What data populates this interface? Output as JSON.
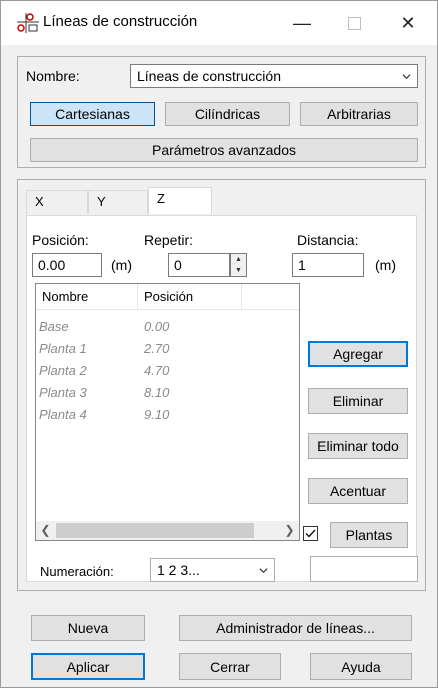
{
  "window": {
    "title": "Líneas de construcción",
    "controls": {
      "minimize": "—",
      "close": "✕"
    }
  },
  "name_section": {
    "label": "Nombre:",
    "value": "Líneas de construcción"
  },
  "coord_buttons": {
    "cartesian": "Cartesianas",
    "cylindrical": "Cilíndricas",
    "arbitrary": "Arbitrarias"
  },
  "advanced_button": "Parámetros avanzados",
  "tabs": [
    "X",
    "Y",
    "Z"
  ],
  "active_tab": "Z",
  "position": {
    "label": "Posición:",
    "value": "0.00",
    "unit": "(m)"
  },
  "repeat": {
    "label": "Repetir:",
    "value": "0"
  },
  "distance": {
    "label": "Distancia:",
    "value": "1",
    "unit": "(m)"
  },
  "list": {
    "columns": [
      "Nombre",
      "Posición"
    ],
    "rows": [
      {
        "name": "Base",
        "position": "0.00"
      },
      {
        "name": "Planta 1",
        "position": "2.70"
      },
      {
        "name": "Planta 2",
        "position": "4.70"
      },
      {
        "name": "Planta 3",
        "position": "8.10"
      },
      {
        "name": "Planta 4",
        "position": "9.10"
      }
    ]
  },
  "side_buttons": {
    "add": "Agregar",
    "delete": "Eliminar",
    "delete_all": "Eliminar todo",
    "accent": "Acentuar",
    "floors": "Plantas"
  },
  "floors_checked": true,
  "numbering": {
    "label": "Numeración:",
    "value": "1 2 3..."
  },
  "bottom_buttons": {
    "new": "Nueva",
    "manager": "Administrador de líneas...",
    "apply": "Aplicar",
    "close": "Cerrar",
    "help": "Ayuda"
  },
  "colors": {
    "accent": "#0078d7",
    "selected_bg": "#cce4f7"
  }
}
